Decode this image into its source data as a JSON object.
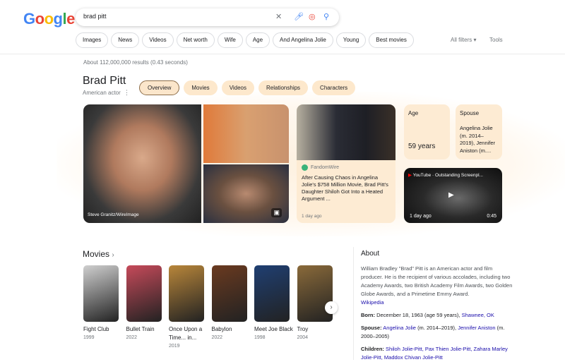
{
  "logo": "Google",
  "search": {
    "query": "brad pitt"
  },
  "chips": [
    "Images",
    "News",
    "Videos",
    "Net worth",
    "Wife",
    "Age",
    "And Angelina Jolie",
    "Young",
    "Best movies"
  ],
  "filters": {
    "all_filters": "All filters ▾",
    "tools": "Tools"
  },
  "result_count": "About 112,000,000 results (0.43 seconds)",
  "entity": {
    "title": "Brad Pitt",
    "subtitle": "American actor",
    "tabs": [
      "Overview",
      "Movies",
      "Videos",
      "Relationships",
      "Characters"
    ],
    "selected_tab": "Overview"
  },
  "images": {
    "credit": "Steve Granitz/WireImage"
  },
  "news": {
    "source": "FandomWire",
    "headline": "After Causing Chaos in Angelina Jolie's $758 Million Movie, Brad Pitt's Daughter Shiloh Got Into a Heated Argument ...",
    "time": "1 day ago"
  },
  "facts": {
    "age_label": "Age",
    "age_value": "59 years",
    "spouse_label": "Spouse",
    "spouse_value": "Angelina Jolie (m. 2014–2019), Jennifer Aniston (m...."
  },
  "video": {
    "source": "YouTube · Outstanding Screenpl...",
    "time": "1 day ago",
    "duration": "0:45"
  },
  "movies": {
    "heading": "Movies",
    "items": [
      {
        "title": "Fight Club",
        "year": "1999",
        "color": "#cfcfcf"
      },
      {
        "title": "Bullet Train",
        "year": "2022",
        "color": "#c64a5a"
      },
      {
        "title": "Once Upon a Time... in...",
        "year": "2019",
        "color": "#b8863a"
      },
      {
        "title": "Babylon",
        "year": "2022",
        "color": "#6a3a20"
      },
      {
        "title": "Meet Joe Black",
        "year": "1998",
        "color": "#1f3f72"
      },
      {
        "title": "Troy",
        "year": "2004",
        "color": "#8a6a3a"
      }
    ]
  },
  "about": {
    "heading": "About",
    "text": "William Bradley \"Brad\" Pitt is an American actor and film producer. He is the recipient of various accolades, including two Academy Awards, two British Academy Film Awards, two Golden Globe Awards, and a Primetime Emmy Award.",
    "source": "Wikipedia",
    "born_label": "Born:",
    "born_text": "December 18, 1963 (age 59 years),",
    "born_place": "Shawnee, OK",
    "spouse_label": "Spouse:",
    "spouse1": "Angelina Jolie",
    "spouse1_years": "(m. 2014–2019),",
    "spouse2": "Jennifer Aniston",
    "spouse2_years": "(m. 2000–2005)",
    "children_label": "Children:",
    "children": "Shiloh Jolie-Pitt, Pax Thien Jolie-Pitt, Zahara Marley Jolie-Pitt, Maddox Chivan Jolie-Pitt"
  }
}
